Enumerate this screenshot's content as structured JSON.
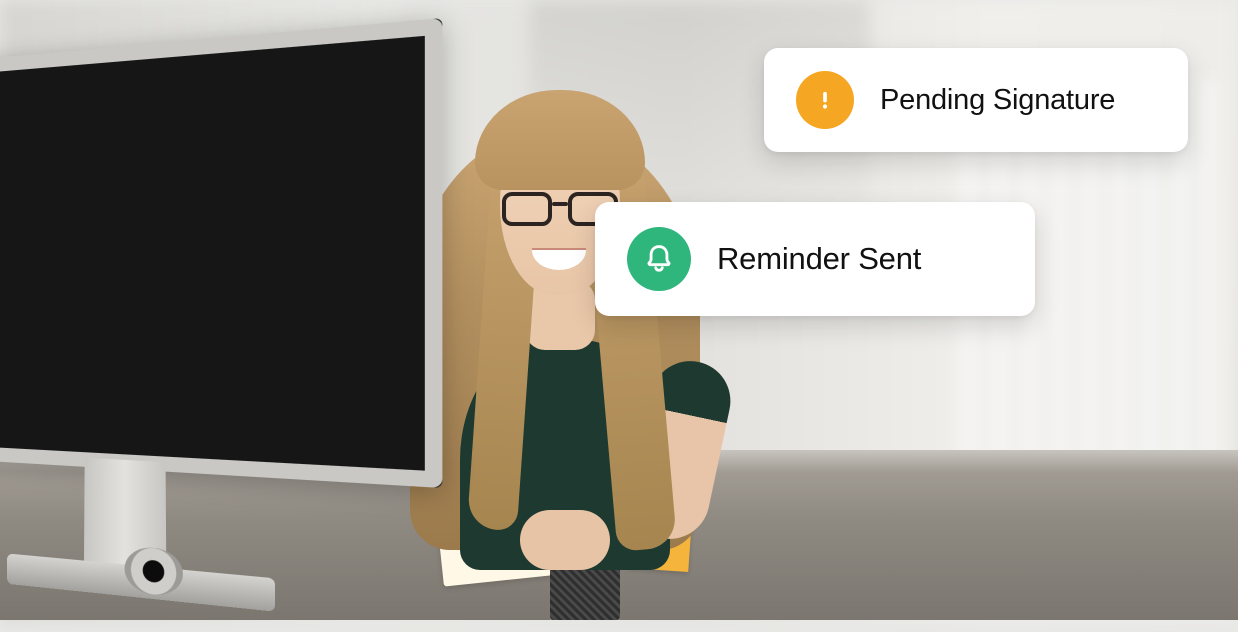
{
  "notifications": {
    "pending": {
      "label": "Pending Signature",
      "icon": "alert-icon",
      "color": "#f5a623"
    },
    "reminder": {
      "label": "Reminder Sent",
      "icon": "bell-icon",
      "color": "#2fb67c"
    }
  }
}
